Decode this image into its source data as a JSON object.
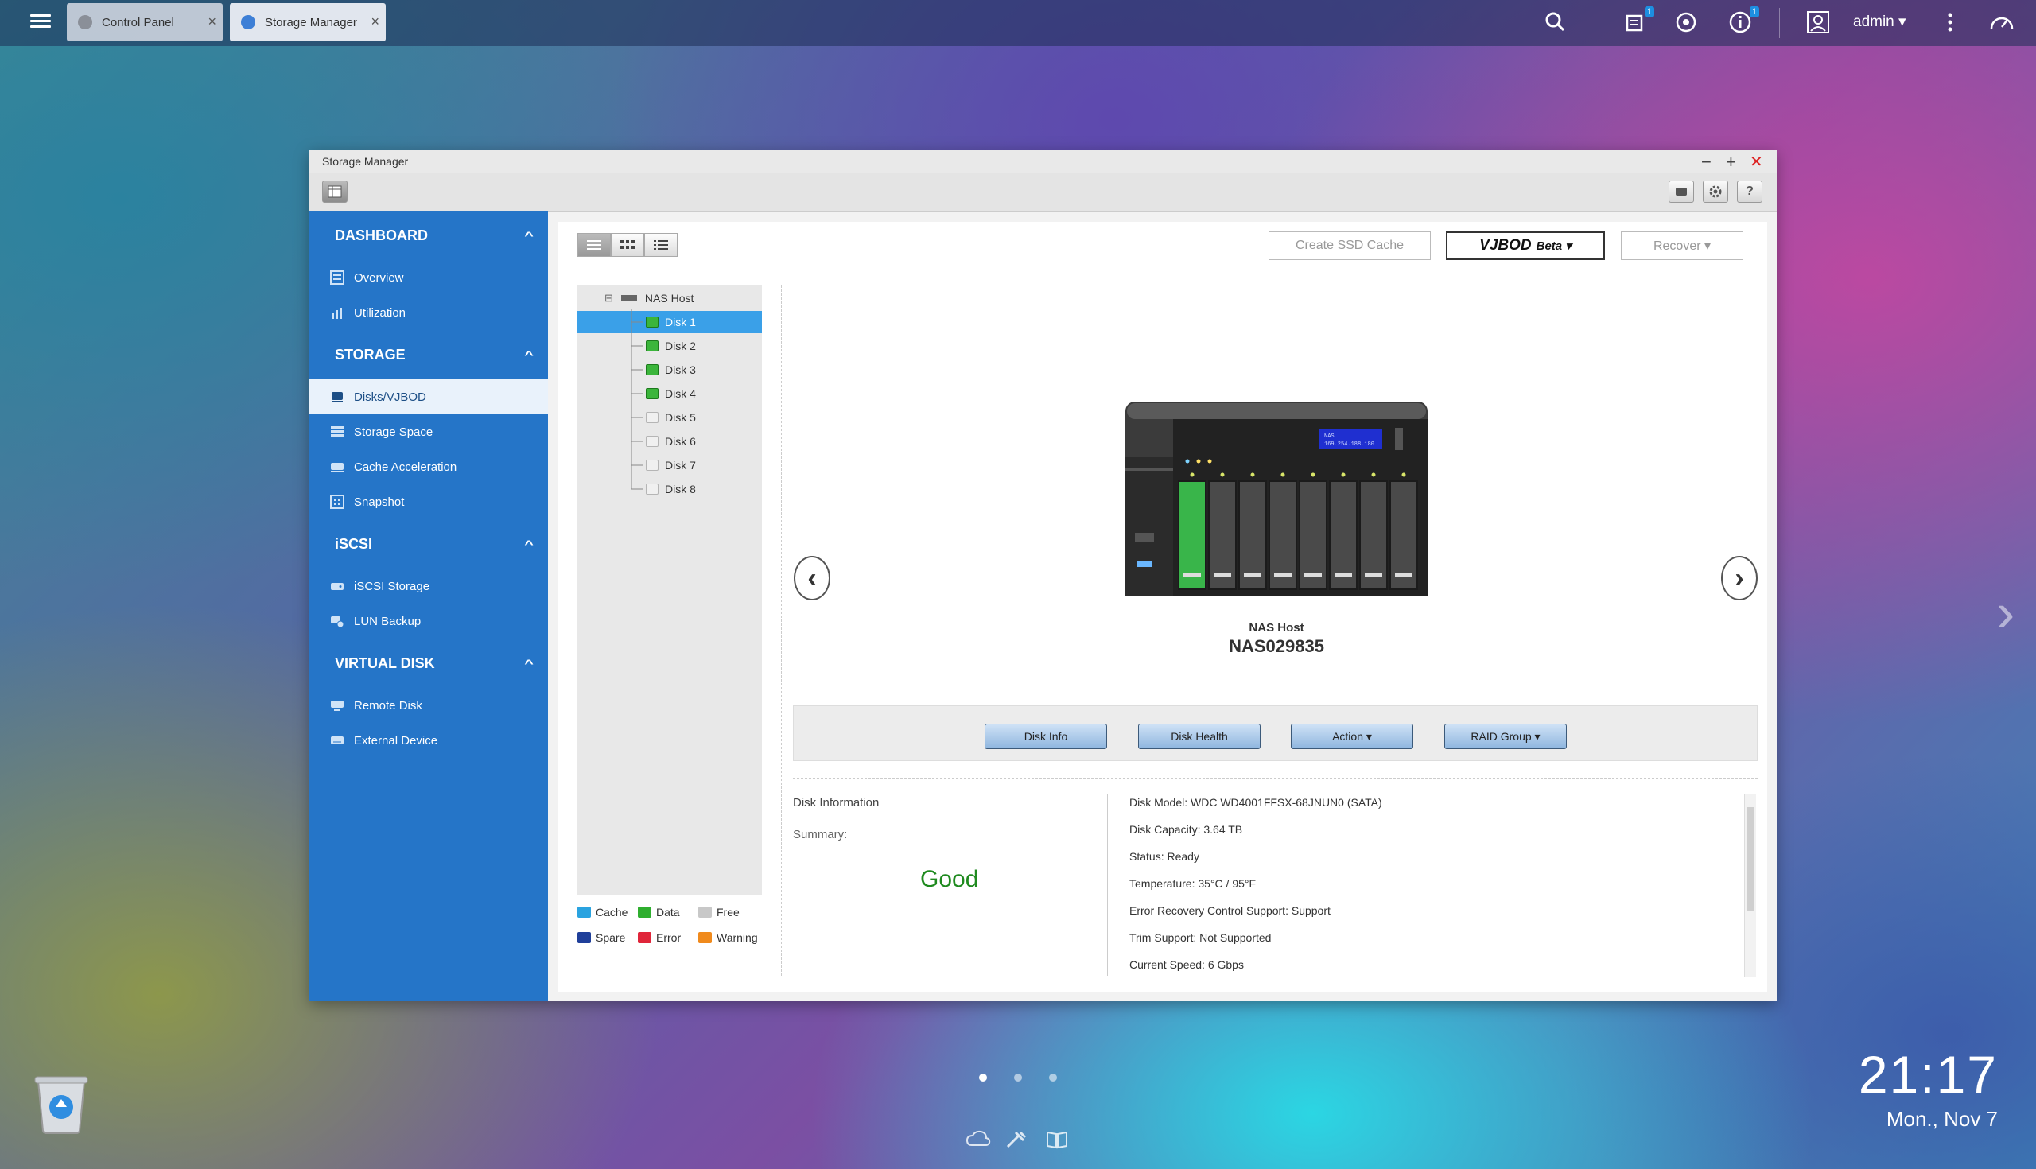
{
  "taskbar": {
    "tabs": [
      {
        "label": "Control Panel",
        "close": "×"
      },
      {
        "label": "Storage Manager",
        "close": "×"
      }
    ],
    "badges": {
      "tasks": "1",
      "info": "1"
    },
    "user": "admin ▾"
  },
  "window": {
    "title": "Storage Manager",
    "controls": {
      "minimize": "−",
      "maximize": "+",
      "close": "✕"
    }
  },
  "sidebar": {
    "sections": [
      {
        "label": "DASHBOARD",
        "items": [
          {
            "label": "Overview"
          },
          {
            "label": "Utilization"
          }
        ]
      },
      {
        "label": "STORAGE",
        "items": [
          {
            "label": "Disks/VJBOD"
          },
          {
            "label": "Storage Space"
          },
          {
            "label": "Cache Acceleration"
          },
          {
            "label": "Snapshot"
          }
        ]
      },
      {
        "label": "iSCSI",
        "items": [
          {
            "label": "iSCSI Storage"
          },
          {
            "label": "LUN Backup"
          }
        ]
      },
      {
        "label": "VIRTUAL DISK",
        "items": [
          {
            "label": "Remote Disk"
          },
          {
            "label": "External Device"
          }
        ]
      }
    ]
  },
  "header_buttons": {
    "create_ssd_cache": "Create SSD Cache",
    "vjbod": "VJBOD",
    "vjbod_beta": "Beta ▾",
    "recover": "Recover ▾"
  },
  "tree": {
    "root": "NAS Host",
    "toggle": "⊟",
    "disks": [
      "Disk 1",
      "Disk 2",
      "Disk 3",
      "Disk 4",
      "Disk 5",
      "Disk 6",
      "Disk 7",
      "Disk 8"
    ]
  },
  "legend": [
    {
      "label": "Cache",
      "color": "#2aa3e0"
    },
    {
      "label": "Data",
      "color": "#2fae2f"
    },
    {
      "label": "Free",
      "color": "#c8c8c8"
    },
    {
      "label": "Spare",
      "color": "#1f3f9a"
    },
    {
      "label": "Error",
      "color": "#e0263a"
    },
    {
      "label": "Warning",
      "color": "#f08a1c"
    }
  ],
  "device": {
    "host_label": "NAS Host",
    "name": "NAS029835",
    "lcd_line1": "NAS",
    "lcd_line2": "169.254.188.180"
  },
  "actions": {
    "disk_info": "Disk Info",
    "disk_health": "Disk Health",
    "action": "Action ▾",
    "raid_group": "RAID Group ▾"
  },
  "disk_info": {
    "heading": "Disk Information",
    "summary_label": "Summary:",
    "summary_value": "Good",
    "lines": [
      "Disk Model: WDC WD4001FFSX-68JNUN0 (SATA)",
      "Disk Capacity: 3.64 TB",
      "Status: Ready",
      "Temperature: 35°C / 95°F",
      "Error Recovery Control Support: Support",
      "Trim Support: Not Supported",
      "Current Speed: 6 Gbps"
    ]
  },
  "clock": {
    "time": "21:17",
    "date": "Mon., Nov 7"
  },
  "colors": {
    "sidebar": "#2575c8",
    "selected": "#3aa0e8",
    "good": "#1f8a1f"
  }
}
